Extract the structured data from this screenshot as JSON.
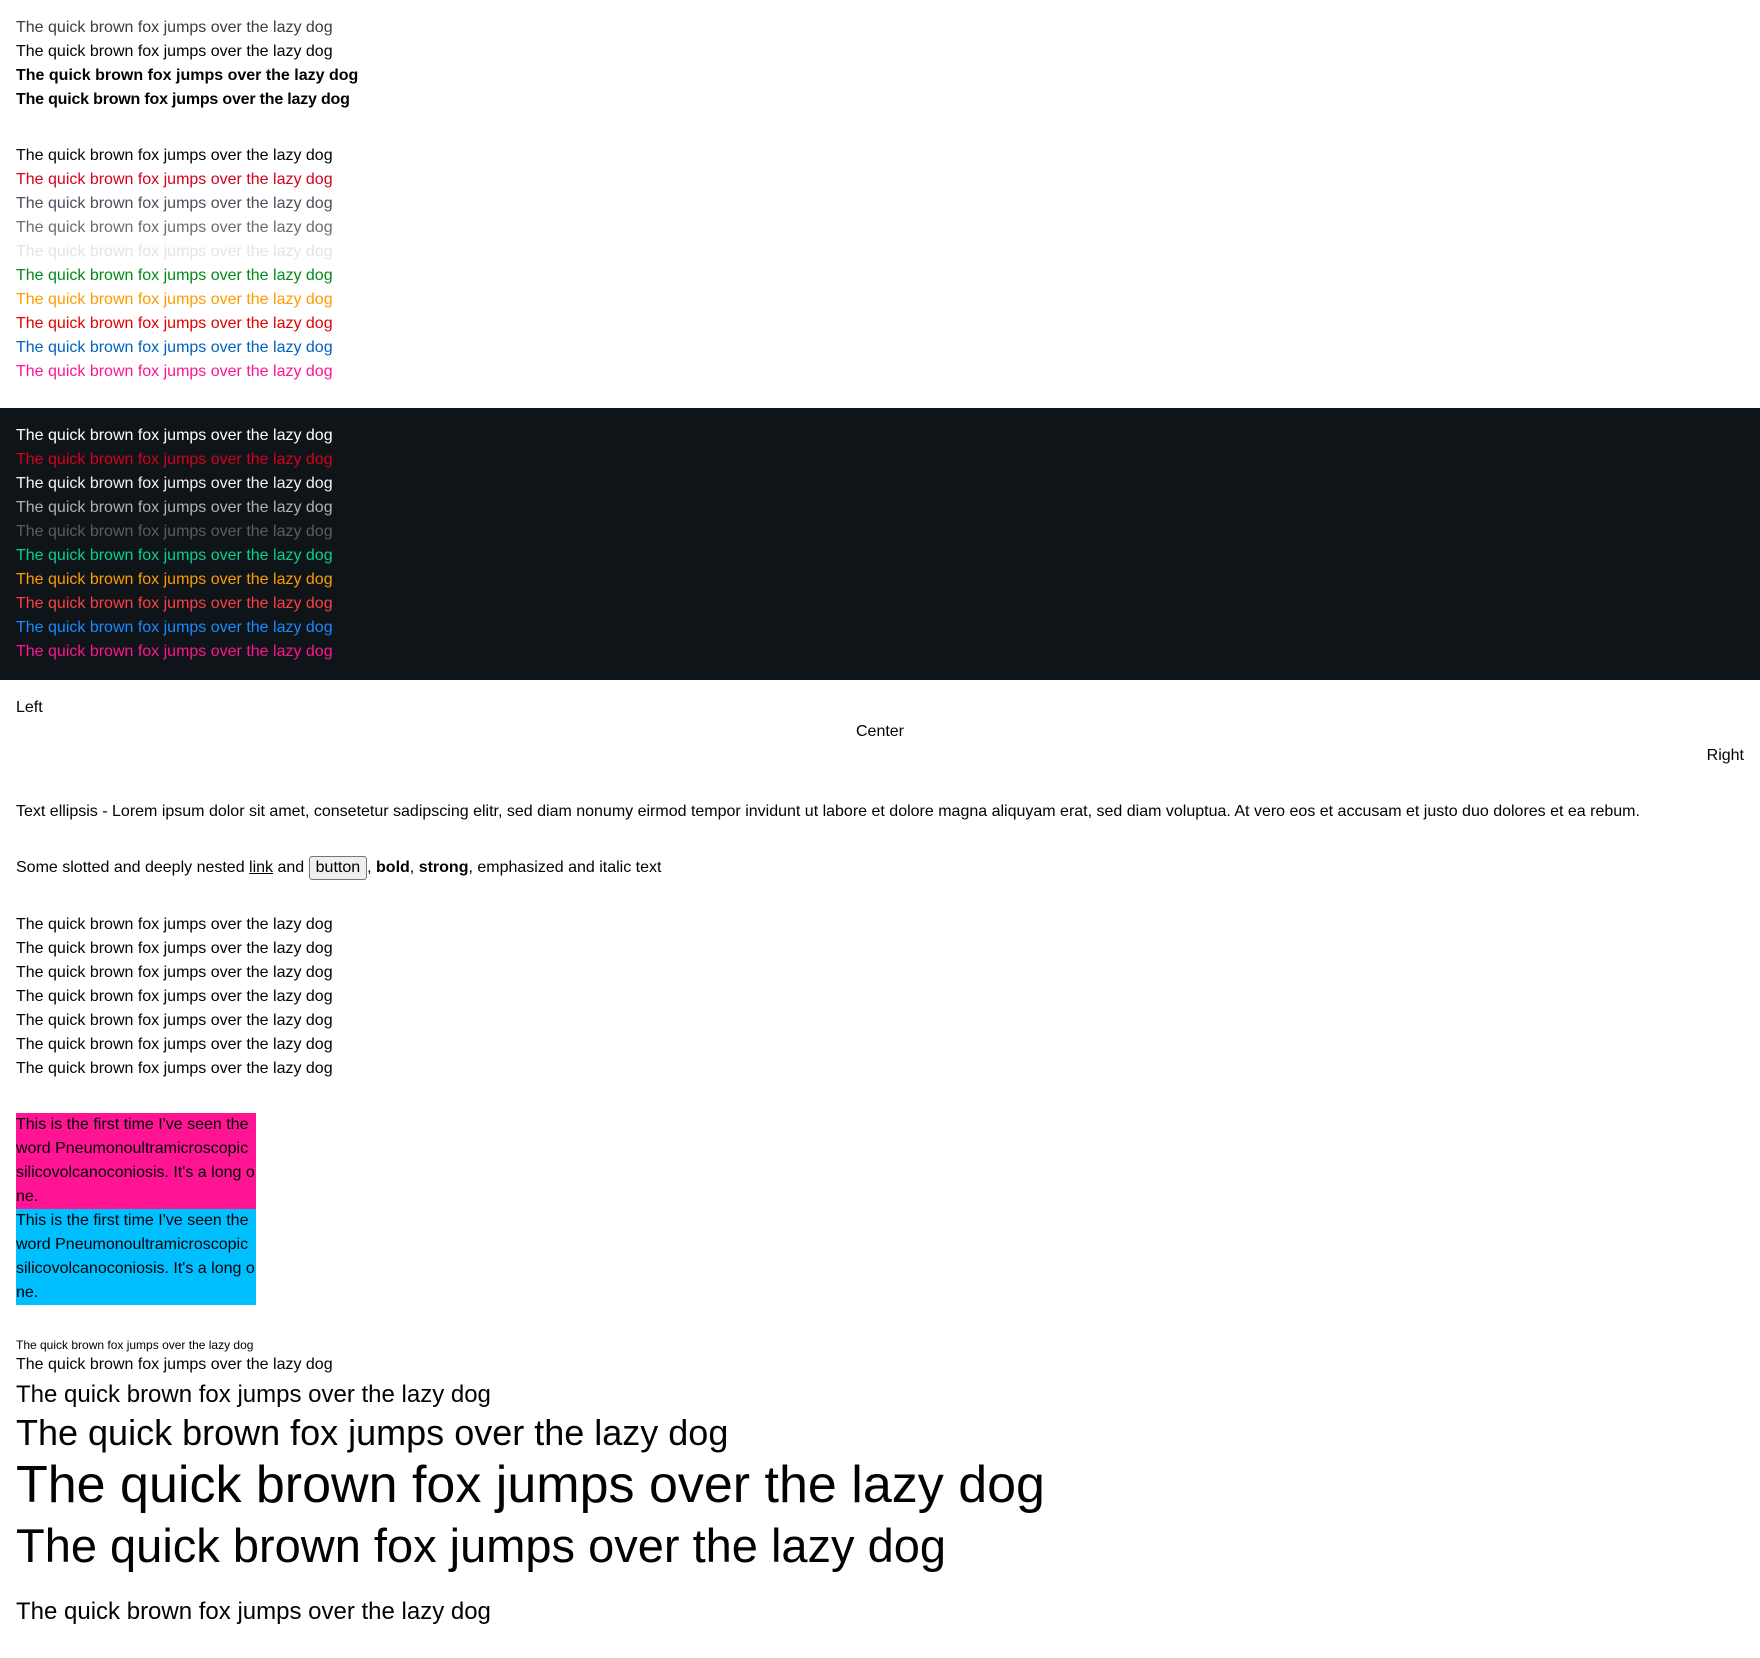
{
  "sample": "The quick brown fox jumps over the lazy dog",
  "weights": [
    {
      "label": "The quick brown fox jumps over the lazy dog"
    },
    {
      "label": "The quick brown fox jumps over the lazy dog"
    },
    {
      "label": "The quick brown fox jumps over the lazy dog"
    },
    {
      "label": "The quick brown fox jumps over the lazy dog"
    }
  ],
  "colors_light": [
    {
      "text": "The quick brown fox jumps over the lazy dog",
      "color": "#010205"
    },
    {
      "text": "The quick brown fox jumps over the lazy dog",
      "color": "#d5001c"
    },
    {
      "text": "The quick brown fox jumps over the lazy dog",
      "color": "#4a4e5a"
    },
    {
      "text": "The quick brown fox jumps over the lazy dog",
      "color": "#6b6d70"
    },
    {
      "text": "The quick brown fox jumps over the lazy dog",
      "color": "#e3e4e5"
    },
    {
      "text": "The quick brown fox jumps over the lazy dog",
      "color": "#018a16"
    },
    {
      "text": "The quick brown fox jumps over the lazy dog",
      "color": "#ff9b00"
    },
    {
      "text": "The quick brown fox jumps over the lazy dog",
      "color": "#e00000"
    },
    {
      "text": "The quick brown fox jumps over the lazy dog",
      "color": "#0061bd"
    },
    {
      "text": "The quick brown fox jumps over the lazy dog",
      "color": "#ff1493"
    }
  ],
  "colors_dark": [
    {
      "text": "The quick brown fox jumps over the lazy dog",
      "color": "#ffffff"
    },
    {
      "text": "The quick brown fox jumps over the lazy dog",
      "color": "#d5001c"
    },
    {
      "text": "The quick brown fox jumps over the lazy dog",
      "color": "#f2f2f2"
    },
    {
      "text": "The quick brown fox jumps over the lazy dog",
      "color": "#b0b1b2"
    },
    {
      "text": "The quick brown fox jumps over the lazy dog",
      "color": "#5a5d60"
    },
    {
      "text": "The quick brown fox jumps over the lazy dog",
      "color": "#09d087"
    },
    {
      "text": "The quick brown fox jumps over the lazy dog",
      "color": "#ff9b00"
    },
    {
      "text": "The quick brown fox jumps over the lazy dog",
      "color": "#fc4040"
    },
    {
      "text": "The quick brown fox jumps over the lazy dog",
      "color": "#178bff"
    },
    {
      "text": "The quick brown fox jumps over the lazy dog",
      "color": "#ff1493"
    }
  ],
  "alignment": {
    "left": "Left",
    "center": "Center",
    "right": "Right"
  },
  "ellipsis_text": "Text ellipsis - Lorem ipsum dolor sit amet, consetetur sadipscing elitr, sed diam nonumy eirmod tempor invidunt ut labore et dolore magna aliquyam erat, sed diam voluptua. At vero eos et accusam et justo duo dolores et ea rebum.",
  "nested": {
    "prefix": "Some slotted and deeply nested ",
    "link": "link",
    "and": " and ",
    "button": "button",
    "comma1": ", ",
    "bold": "bold",
    "comma2": ", ",
    "strong": "strong",
    "suffix": ", emphasized and italic text"
  },
  "repeat_lines": [
    "The quick brown fox jumps over the lazy dog",
    "The quick brown fox jumps over the lazy dog",
    "The quick brown fox jumps over the lazy dog",
    "The quick brown fox jumps over the lazy dog",
    "The quick brown fox jumps over the lazy dog",
    "The quick brown fox jumps over the lazy dog",
    "The quick brown fox jumps over the lazy dog"
  ],
  "wrap_text": "This is the first time I've seen the word Pneumonoultramicroscopicsilicovolcanoconiosis. It's a long one.",
  "box_colors": {
    "pink": "#ff1493",
    "cyan": "#00bfff"
  },
  "sizes": [
    "The quick brown fox jumps over the lazy dog",
    "The quick brown fox jumps over the lazy dog",
    "The quick brown fox jumps over the lazy dog",
    "The quick brown fox jumps over the lazy dog",
    "The quick brown fox jumps over the lazy dog",
    "The quick brown fox jumps over the lazy dog",
    "The quick brown fox jumps over the lazy dog"
  ]
}
